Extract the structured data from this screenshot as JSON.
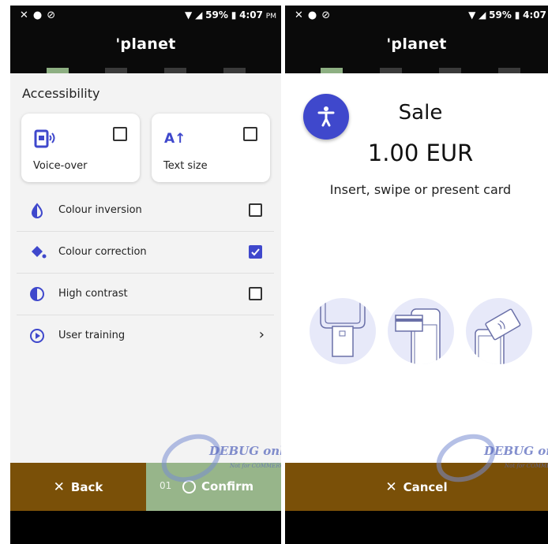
{
  "status_bar": {
    "left_icons": [
      "bluetooth-off-icon",
      "dnd-icon",
      "blocked-icon"
    ],
    "battery": "59%",
    "time_left": "4:07",
    "ampm": "PM",
    "time_right": "4:07"
  },
  "brand": "'planet",
  "left_screen": {
    "section_title": "Accessibility",
    "cards": [
      {
        "label": "Voice-over",
        "icon": "voice-over-icon",
        "checked": false
      },
      {
        "label": "Text size",
        "icon": "text-size-icon",
        "icon_text": "A↑",
        "checked": false
      }
    ],
    "options": [
      {
        "label": "Colour inversion",
        "icon": "colour-inversion-icon",
        "checked": false
      },
      {
        "label": "Colour correction",
        "icon": "colour-correction-icon",
        "checked": true
      },
      {
        "label": "High contrast",
        "icon": "high-contrast-icon",
        "checked": false
      },
      {
        "label": "User training",
        "icon": "play-circle-icon",
        "chevron": "›"
      }
    ],
    "back_label": "Back",
    "confirm_count": "01",
    "confirm_label": "Confirm"
  },
  "right_screen": {
    "title": "Sale",
    "amount": "1.00 EUR",
    "instruction": "Insert, swipe or present card",
    "methods": [
      "insert-card-icon",
      "swipe-card-icon",
      "contactless-card-icon"
    ],
    "cancel_label": "Cancel"
  },
  "watermark": {
    "text": "DEBUG only",
    "subtext": "Not for COMMERCIAL"
  },
  "colors": {
    "accent": "#3f48cc",
    "brown": "#7a5008",
    "green": "#97b58a",
    "step_active": "#8daf82"
  }
}
